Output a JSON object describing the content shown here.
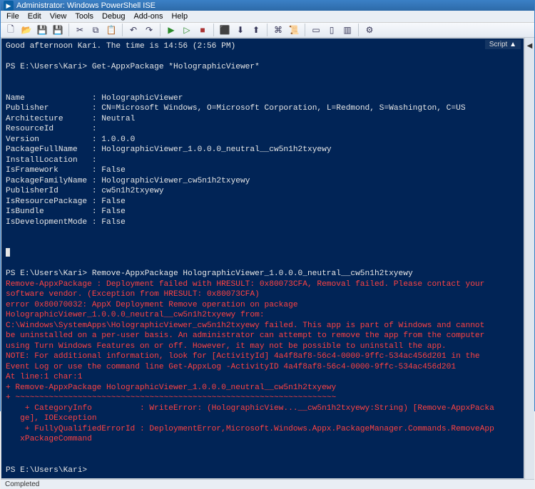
{
  "window": {
    "title": "Administrator: Windows PowerShell ISE"
  },
  "menu": {
    "file": "File",
    "edit": "Edit",
    "view": "View",
    "tools": "Tools",
    "debug": "Debug",
    "addons": "Add-ons",
    "help": "Help"
  },
  "side": {
    "script": "Script",
    "collapse": "▲"
  },
  "status": {
    "text": "Completed"
  },
  "console": {
    "greeting": "Good afternoon Kari. The time is 14:56 (2:56 PM)",
    "prompt1": "PS E:\\Users\\Kari> Get-AppxPackage *HolographicViewer*",
    "blank": "",
    "pkg": {
      "name_k": "Name",
      "name_v": "HolographicViewer",
      "pub_k": "Publisher",
      "pub_v": "CN=Microsoft Windows, O=Microsoft Corporation, L=Redmond, S=Washington, C=US",
      "arch_k": "Architecture",
      "arch_v": "Neutral",
      "res_k": "ResourceId",
      "res_v": "",
      "ver_k": "Version",
      "ver_v": "1.0.0.0",
      "pfn_k": "PackageFullName",
      "pfn_v": "HolographicViewer_1.0.0.0_neutral__cw5n1h2txyewy",
      "loc_k": "InstallLocation",
      "loc_v": "",
      "fw_k": "IsFramework",
      "fw_v": "False",
      "fam_k": "PackageFamilyName",
      "fam_v": "HolographicViewer_cw5n1h2txyewy",
      "pubid_k": "PublisherId",
      "pubid_v": "cw5n1h2txyewy",
      "isres_k": "IsResourcePackage",
      "isres_v": "False",
      "bun_k": "IsBundle",
      "bun_v": "False",
      "dev_k": "IsDevelopmentMode",
      "dev_v": "False"
    },
    "prompt2": "PS E:\\Users\\Kari> Remove-AppxPackage HolographicViewer_1.0.0.0_neutral__cw5n1h2txyewy",
    "err1": "Remove-AppxPackage : Deployment failed with HRESULT: 0x80073CFA, Removal failed. Please contact your",
    "err2": "software vendor. (Exception from HRESULT: 0x80073CFA)",
    "err3": "error 0x80070032: AppX Deployment Remove operation on package",
    "err4": "HolographicViewer_1.0.0.0_neutral__cw5n1h2txyewy from:",
    "err5": "C:\\Windows\\SystemApps\\HolographicViewer_cw5n1h2txyewy failed. This app is part of Windows and cannot",
    "err6": "be uninstalled on a per-user basis. An administrator can attempt to remove the app from the computer",
    "err7": "using Turn Windows Features on or off. However, it may not be possible to uninstall the app.",
    "err8": "NOTE: For additional information, look for [ActivityId] 4a4f8af8-56c4-0000-9ffc-534ac456d201 in the",
    "err9": "Event Log or use the command line Get-AppxLog -ActivityID 4a4f8af8-56c4-0000-9ffc-534ac456d201",
    "err10": "At line:1 char:1",
    "err11": "+ Remove-AppxPackage HolographicViewer_1.0.0.0_neutral__cw5n1h2txyewy",
    "err12": "+ ~~~~~~~~~~~~~~~~~~~~~~~~~~~~~~~~~~~~~~~~~~~~~~~~~~~~~~~~~~~~~~~~~~~",
    "err13": "    + CategoryInfo          : WriteError: (HolographicView...__cw5n1h2txyewy:String) [Remove-AppxPacka",
    "err14": "   ge], IOException",
    "err15": "    + FullyQualifiedErrorId : DeploymentError,Microsoft.Windows.Appx.PackageManager.Commands.RemoveApp",
    "err16": "   xPackageCommand",
    "prompt3": "PS E:\\Users\\Kari> "
  },
  "icons": {
    "new": "🗋",
    "open": "📂",
    "save": "💾",
    "saveall": "💾",
    "cut": "✂",
    "copy": "⧉",
    "paste": "📋",
    "undo": "↶",
    "redo": "↷",
    "run": "▶",
    "runsel": "▷",
    "stop": "■",
    "break": "⬛",
    "step": "⬇",
    "out": "⬆",
    "cmd": "⌘",
    "script": "📜",
    "panel1": "▭",
    "panel2": "▯",
    "panel3": "▥",
    "opts": "⚙"
  }
}
